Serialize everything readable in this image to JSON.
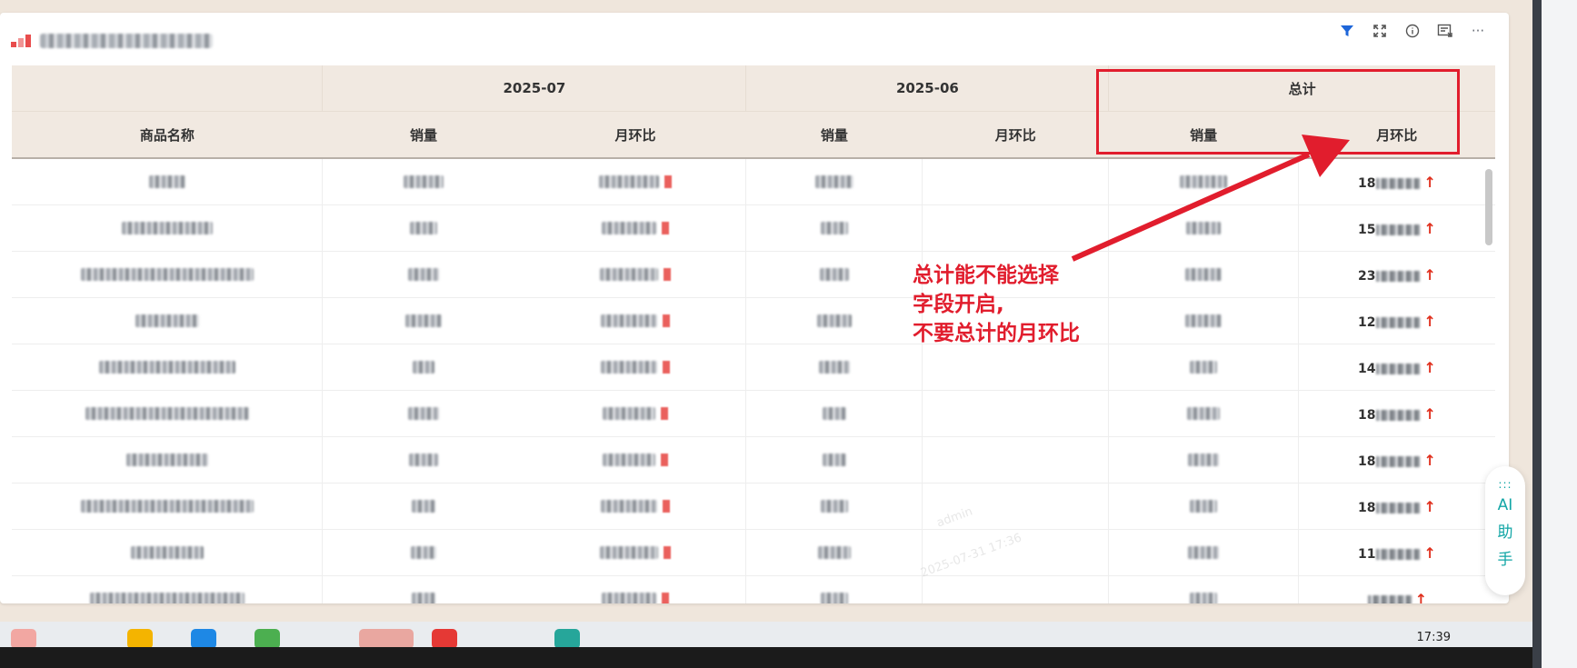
{
  "table": {
    "header_groups": [
      "",
      "2025-07",
      "2025-06",
      "总计"
    ],
    "columns": [
      "商品名称",
      "销量",
      "月环比",
      "销量",
      "月环比",
      "销量",
      "月环比"
    ],
    "total_mom_prefixes": [
      "18",
      "15",
      "23",
      "12",
      "14",
      "18",
      "18",
      "18",
      "11"
    ]
  },
  "annotation": {
    "lines": [
      "总计能不能选择",
      "字段开启,",
      "不要总计的月环比"
    ],
    "color": "#e11d2d"
  },
  "ai_assistant": {
    "dots": ":::",
    "chars": [
      "AI",
      "助",
      "手"
    ]
  },
  "watermark": [
    "admin",
    "2025-07-31 17:36"
  ],
  "taskbar": {
    "time": "17:39"
  },
  "icons": [
    "filter-icon",
    "fullscreen-icon",
    "info-icon",
    "export-icon",
    "more-icon",
    "arrow-up-icon"
  ],
  "colors": {
    "header_bg": "#f1e9e1",
    "accent_red": "#e11d2d",
    "ai_teal": "#12a6a6"
  }
}
